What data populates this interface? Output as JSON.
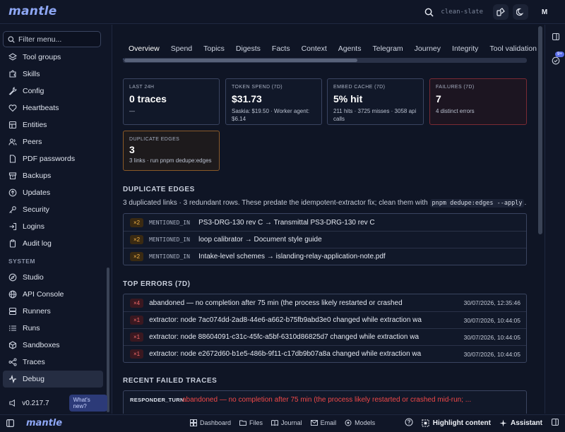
{
  "app": {
    "logo": "mantle",
    "theme_label": "clean-slate",
    "avatar_initial": "M",
    "version": "v0.217.7",
    "whats_new": "What's new?"
  },
  "sidebar": {
    "filter_placeholder": "Filter menu...",
    "items": [
      {
        "label": "Tool groups",
        "icon": "layers-icon"
      },
      {
        "label": "Skills",
        "icon": "puzzle-icon"
      },
      {
        "label": "Config",
        "icon": "wrench-icon"
      },
      {
        "label": "Heartbeats",
        "icon": "heart-icon"
      },
      {
        "label": "Entities",
        "icon": "entities-icon"
      },
      {
        "label": "Peers",
        "icon": "users-icon"
      },
      {
        "label": "PDF passwords",
        "icon": "document-lock-icon"
      },
      {
        "label": "Backups",
        "icon": "archive-icon"
      },
      {
        "label": "Updates",
        "icon": "upload-circle-icon"
      },
      {
        "label": "Security",
        "icon": "key-icon"
      },
      {
        "label": "Logins",
        "icon": "login-icon"
      },
      {
        "label": "Audit log",
        "icon": "clipboard-icon"
      }
    ],
    "system_label": "SYSTEM",
    "system_items": [
      {
        "label": "Studio",
        "icon": "compass-icon"
      },
      {
        "label": "API Console",
        "icon": "globe-icon"
      },
      {
        "label": "Runners",
        "icon": "server-icon"
      },
      {
        "label": "Runs",
        "icon": "list-icon"
      },
      {
        "label": "Sandboxes",
        "icon": "box-icon"
      },
      {
        "label": "Traces",
        "icon": "network-icon"
      },
      {
        "label": "Debug",
        "icon": "activity-icon"
      }
    ]
  },
  "tabs": [
    "Overview",
    "Spend",
    "Topics",
    "Digests",
    "Facts",
    "Context",
    "Agents",
    "Telegram",
    "Journey",
    "Integrity",
    "Tool validation"
  ],
  "cards": {
    "last24": {
      "label": "LAST 24H",
      "value": "0 traces",
      "sub": "—"
    },
    "token": {
      "label": "TOKEN SPEND (7D)",
      "value": "$31.73",
      "sub": "Saskia: $19.50 · Worker agent: $6.14"
    },
    "embed": {
      "label": "EMBED CACHE (7D)",
      "value": "5% hit",
      "sub": "211 hits · 3725 misses · 3058 api calls"
    },
    "failures": {
      "label": "FAILURES (7D)",
      "value": "7",
      "sub": "4 distinct errors"
    },
    "dupes": {
      "label": "DUPLICATE EDGES",
      "value": "3",
      "sub": "3 links · run pnpm dedupe:edges"
    }
  },
  "duplicate_edges": {
    "title": "DUPLICATE EDGES",
    "desc_before": "3 duplicated links · 3 redundant rows. These predate the idempotent-extractor fix; clean them with",
    "desc_code": "pnpm dedupe:edges --apply",
    "desc_after": ".",
    "rows": [
      {
        "badge": "×2",
        "kind": "MENTIONED_IN",
        "text": "PS3-DRG-130 rev C → Transmittal PS3-DRG-130 rev C"
      },
      {
        "badge": "×2",
        "kind": "MENTIONED_IN",
        "text": "loop calibrator → Document style guide"
      },
      {
        "badge": "×2",
        "kind": "MENTIONED_IN",
        "text": "Intake-level schemes → islanding-relay-application-note.pdf"
      }
    ]
  },
  "top_errors": {
    "title": "TOP ERRORS (7D)",
    "rows": [
      {
        "badge": "×4",
        "text": "abandoned — no completion after 75 min (the process likely restarted or crashed",
        "time": "30/07/2026, 12:35:46"
      },
      {
        "badge": "×1",
        "text": "extractor: node 7ac074dd-2ad8-44e6-a662-b75fb9abd3e0 changed while extraction wa",
        "time": "30/07/2026, 10:44:05"
      },
      {
        "badge": "×1",
        "text": "extractor: node 88604091-c31c-45fc-a5bf-6310d86825d7 changed while extraction wa",
        "time": "30/07/2026, 10:44:05"
      },
      {
        "badge": "×1",
        "text": "extractor: node e2672d60-b1e5-486b-9f11-c17db9b07a8a changed while extraction wa",
        "time": "30/07/2026, 10:44:05"
      }
    ]
  },
  "recent_failed": {
    "title": "RECENT FAILED TRACES",
    "rows": [
      {
        "kind": "RESPONDER_TURN",
        "text": "abandoned — no completion after 75 min (the process likely restarted or crashed mid-run; ..."
      }
    ]
  },
  "bottom_nav": [
    {
      "label": "Dashboard",
      "icon": "dashboard-icon"
    },
    {
      "label": "Files",
      "icon": "folder-icon"
    },
    {
      "label": "Journal",
      "icon": "book-icon"
    },
    {
      "label": "Email",
      "icon": "mail-icon"
    },
    {
      "label": "Models",
      "icon": "models-icon"
    }
  ],
  "bottom_right": {
    "highlight": "Highlight content",
    "assistant": "Assistant"
  },
  "rail": {
    "badge": "9+"
  }
}
